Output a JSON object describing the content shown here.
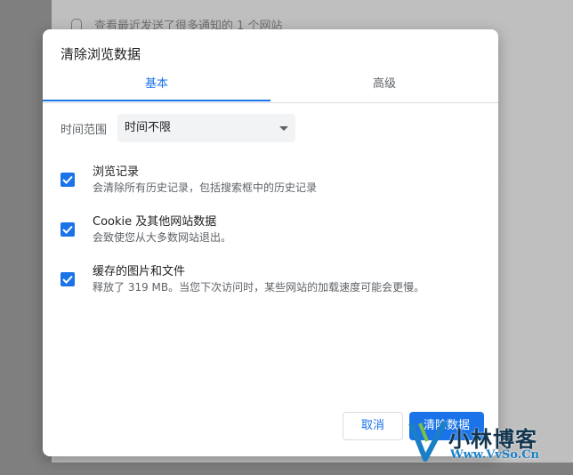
{
  "background": {
    "notice_text": "查看最近发送了很多通知的 1 个网站"
  },
  "dialog": {
    "title": "清除浏览数据",
    "tabs": [
      {
        "label": "基本",
        "selected": true
      },
      {
        "label": "高级",
        "selected": false
      }
    ],
    "time_range": {
      "label": "时间范围",
      "value": "时间不限"
    },
    "options": [
      {
        "title": "浏览记录",
        "description": "会清除所有历史记录，包括搜索框中的历史记录",
        "checked": true
      },
      {
        "title": "Cookie 及其他网站数据",
        "description": "会致使您从大多数网站退出。",
        "checked": true
      },
      {
        "title": "缓存的图片和文件",
        "description": "释放了 319 MB。当您下次访问时，某些网站的加载速度可能会更慢。",
        "checked": true
      }
    ],
    "buttons": {
      "cancel": "取消",
      "clear": "清除数据"
    }
  },
  "watermark": {
    "name": "小林博客",
    "url": "Www.VvSo.Cn"
  },
  "colors": {
    "accent": "#1a73e8",
    "overlay": "#7f7f7f"
  }
}
